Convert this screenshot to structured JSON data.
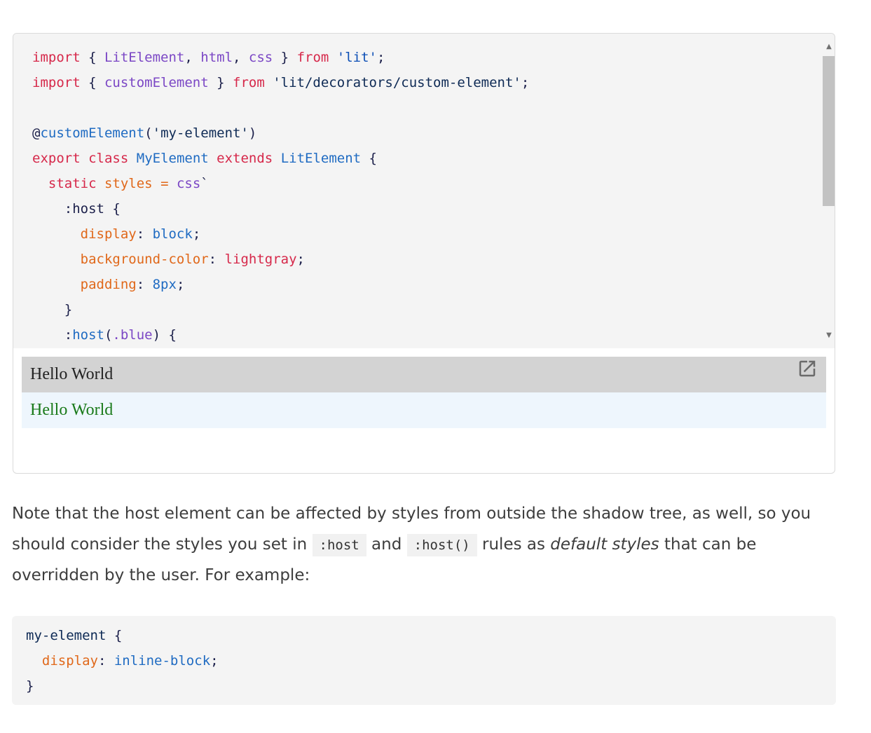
{
  "editor": {
    "code_lines": [
      [
        {
          "t": "import",
          "c": "kw"
        },
        {
          "t": " { ",
          "c": "punct"
        },
        {
          "t": "LitElement",
          "c": "id"
        },
        {
          "t": ", ",
          "c": "punct"
        },
        {
          "t": "html",
          "c": "id"
        },
        {
          "t": ", ",
          "c": "punct"
        },
        {
          "t": "css",
          "c": "id"
        },
        {
          "t": " } ",
          "c": "punct"
        },
        {
          "t": "from",
          "c": "kw"
        },
        {
          "t": " ",
          "c": "punct"
        },
        {
          "t": "'lit'",
          "c": "strq"
        },
        {
          "t": ";",
          "c": "punct"
        }
      ],
      [
        {
          "t": "import",
          "c": "kw"
        },
        {
          "t": " { ",
          "c": "punct"
        },
        {
          "t": "customElement",
          "c": "id"
        },
        {
          "t": " } ",
          "c": "punct"
        },
        {
          "t": "from",
          "c": "kw"
        },
        {
          "t": " ",
          "c": "punct"
        },
        {
          "t": "'lit/decorators/custom-element'",
          "c": "str"
        },
        {
          "t": ";",
          "c": "punct"
        }
      ],
      [],
      [
        {
          "t": "@",
          "c": "punct"
        },
        {
          "t": "customElement",
          "c": "fn"
        },
        {
          "t": "(",
          "c": "punct"
        },
        {
          "t": "'my-element'",
          "c": "str"
        },
        {
          "t": ")",
          "c": "punct"
        }
      ],
      [
        {
          "t": "export",
          "c": "kw"
        },
        {
          "t": " ",
          "c": "punct"
        },
        {
          "t": "class",
          "c": "kw"
        },
        {
          "t": " ",
          "c": "punct"
        },
        {
          "t": "MyElement",
          "c": "fn"
        },
        {
          "t": " ",
          "c": "punct"
        },
        {
          "t": "extends",
          "c": "kw"
        },
        {
          "t": " ",
          "c": "punct"
        },
        {
          "t": "LitElement",
          "c": "fn"
        },
        {
          "t": " {",
          "c": "punct"
        }
      ],
      [
        {
          "t": "  ",
          "c": "punct"
        },
        {
          "t": "static",
          "c": "kw"
        },
        {
          "t": " ",
          "c": "punct"
        },
        {
          "t": "styles",
          "c": "prop"
        },
        {
          "t": " = ",
          "c": "prop"
        },
        {
          "t": "css",
          "c": "id"
        },
        {
          "t": "`",
          "c": "punct"
        }
      ],
      [
        {
          "t": "    :host {",
          "c": "punct"
        }
      ],
      [
        {
          "t": "      ",
          "c": "punct"
        },
        {
          "t": "display",
          "c": "prop"
        },
        {
          "t": ": ",
          "c": "punct"
        },
        {
          "t": "block",
          "c": "val"
        },
        {
          "t": ";",
          "c": "punct"
        }
      ],
      [
        {
          "t": "      ",
          "c": "punct"
        },
        {
          "t": "background-color",
          "c": "prop"
        },
        {
          "t": ": ",
          "c": "punct"
        },
        {
          "t": "lightgray",
          "c": "red"
        },
        {
          "t": ";",
          "c": "punct"
        }
      ],
      [
        {
          "t": "      ",
          "c": "punct"
        },
        {
          "t": "padding",
          "c": "prop"
        },
        {
          "t": ": ",
          "c": "punct"
        },
        {
          "t": "8px",
          "c": "val"
        },
        {
          "t": ";",
          "c": "punct"
        }
      ],
      [
        {
          "t": "    }",
          "c": "punct"
        }
      ],
      [
        {
          "t": "    :",
          "c": "punct"
        },
        {
          "t": "host",
          "c": "fn"
        },
        {
          "t": "(",
          "c": "punct"
        },
        {
          "t": ".blue",
          "c": "id"
        },
        {
          "t": ") {",
          "c": "punct"
        }
      ]
    ]
  },
  "preview": {
    "row1_text": "Hello World",
    "row2_text": "Hello World",
    "open_icon": "open-in-new-icon"
  },
  "paragraph": {
    "part1": "Note that the host element can be affected by styles from outside the shadow tree, as well, so you should consider the styles you set in ",
    "code1": ":host",
    "part2": " and ",
    "code2": ":host()",
    "part3": " rules as ",
    "emphasis": "default styles",
    "part4": " that can be overridden by the user. For example:"
  },
  "example_code": {
    "lines": [
      [
        {
          "t": "my-element",
          "c": "str"
        },
        {
          "t": " {",
          "c": "punct"
        }
      ],
      [
        {
          "t": "  ",
          "c": "punct"
        },
        {
          "t": "display",
          "c": "prop"
        },
        {
          "t": ": ",
          "c": "punct"
        },
        {
          "t": "inline-block",
          "c": "val"
        },
        {
          "t": ";",
          "c": "punct"
        }
      ],
      [
        {
          "t": "}",
          "c": "punct"
        }
      ]
    ]
  },
  "colors": {
    "keyword": "#d6284a",
    "identifier": "#7b47c5",
    "string": "#0e2a55",
    "function": "#1f6bc2",
    "property": "#e0681a",
    "preview_gray": "#d3d3d3",
    "preview_blue_bg": "#eef6fd",
    "preview_green_text": "#1a7a1a"
  }
}
